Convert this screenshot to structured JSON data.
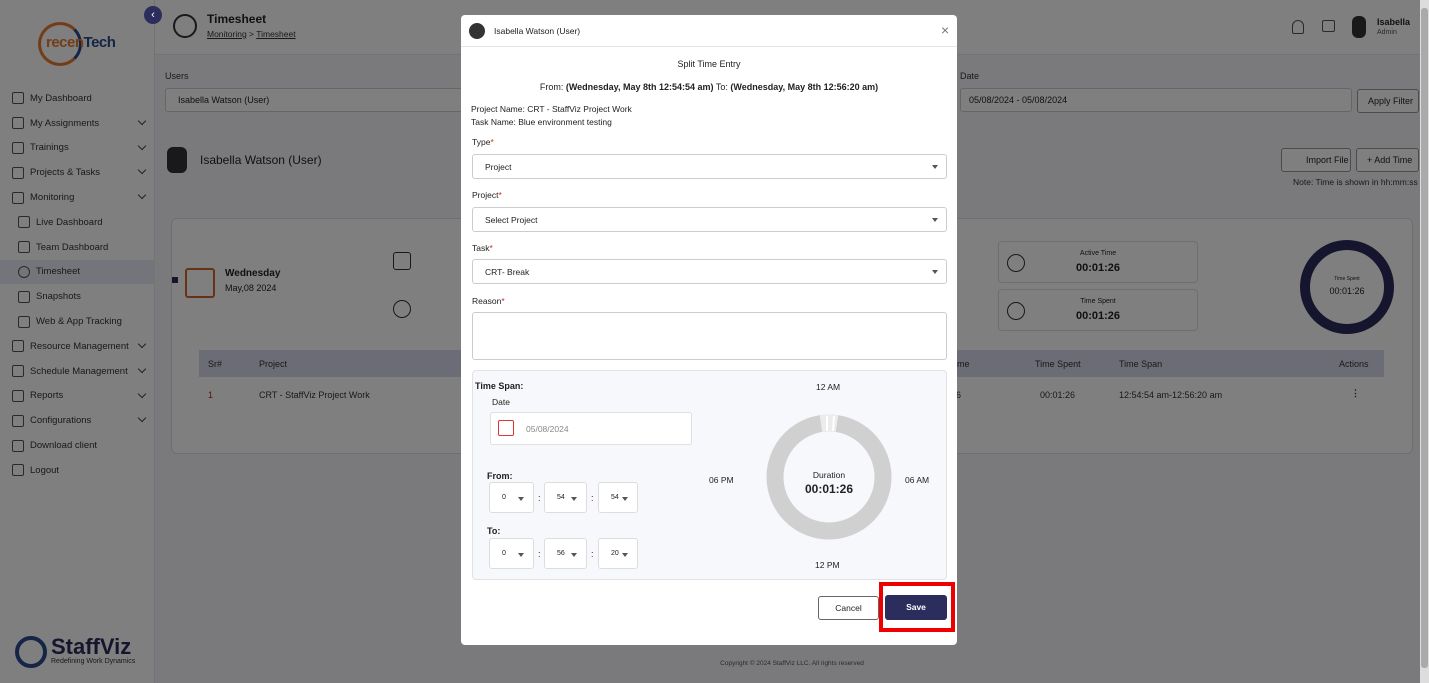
{
  "sidebar": {
    "logo_text_a": "recen",
    "logo_text_b": "Tech",
    "items": [
      {
        "label": "My Dashboard"
      },
      {
        "label": "My Assignments"
      },
      {
        "label": "Trainings"
      },
      {
        "label": "Projects & Tasks"
      },
      {
        "label": "Monitoring"
      },
      {
        "label": "Live Dashboard"
      },
      {
        "label": "Team Dashboard"
      },
      {
        "label": "Timesheet"
      },
      {
        "label": "Snapshots"
      },
      {
        "label": "Web & App Tracking"
      },
      {
        "label": "Resource Management"
      },
      {
        "label": "Schedule Management"
      },
      {
        "label": "Reports"
      },
      {
        "label": "Configurations"
      },
      {
        "label": "Download client"
      },
      {
        "label": "Logout"
      }
    ],
    "brand_name": "StaffViz",
    "brand_tagline": "Redefining Work Dynamics",
    "collapse_glyph": "‹"
  },
  "header": {
    "title": "Timesheet",
    "crumb_1": "Monitoring",
    "crumb_sep": " > ",
    "crumb_2": "Timesheet",
    "user_name": "Isabella",
    "user_role": "Admin"
  },
  "filters": {
    "users_label": "Users",
    "users_value": "Isabella Watson (User)",
    "date_label": "Date",
    "date_value": "05/08/2024 - 05/08/2024",
    "apply_label": "Apply Filter",
    "import_label": "Import File",
    "add_time_label": "+ Add Time",
    "note": "Note: Time is shown in hh:mm:ss"
  },
  "user_row": {
    "name": "Isabella Watson (User)"
  },
  "day": {
    "name": "Wednesday",
    "date": "May,08 2024"
  },
  "stats": [
    {
      "label": "Active Time",
      "value": "00:01:26"
    },
    {
      "label": "Time Spent",
      "value": "00:01:26"
    }
  ],
  "ring": {
    "label": "Time Spent",
    "value": "00:01:26"
  },
  "table": {
    "headers": [
      "Sr#",
      "Project",
      "me",
      "Time Spent",
      "Time Span",
      "Actions"
    ],
    "row": {
      "sr": "1",
      "project": "CRT - StaffViz Project Work",
      "me": "6",
      "time_spent": "00:01:26",
      "span": "12:54:54 am-12:56:20 am",
      "actions": "⋮"
    }
  },
  "footer": "Copyright © 2024 StaffViz LLC. All rights reserved",
  "modal": {
    "user": "Isabella Watson (User)",
    "close": "×",
    "title": "Split Time Entry",
    "range_from_label": "From: ",
    "range_from": "(Wednesday, May 8th 12:54:54 am)",
    "range_to_label": " To: ",
    "range_to": "(Wednesday, May 8th 12:56:20 am)",
    "project_name_label": "Project Name:",
    "project_name": "CRT - StaffViz Project Work",
    "task_name_label": "Task Name:",
    "task_name": "Blue environment testing",
    "type_label": "Type",
    "type_value": "Project",
    "project_label": "Project",
    "project_value": "Select Project",
    "task_label": "Task",
    "task_value": "CRT- Break",
    "reason_label": "Reason",
    "req": "*",
    "timespan_label": "Time Span:",
    "date_label": "Date",
    "date_value": "05/08/2024",
    "from_label": "From:",
    "from": {
      "h": "0",
      "m": "54",
      "s": "54"
    },
    "to_label": "To:",
    "to": {
      "h": "0",
      "m": "56",
      "s": "20"
    },
    "colon": ":",
    "clock": {
      "top": "12 AM",
      "left": "06 PM",
      "right": "06 AM",
      "bottom": "12 PM"
    },
    "duration_label": "Duration",
    "duration_value": "00:01:26",
    "cancel_label": "Cancel",
    "save_label": "Save",
    "colors": {
      "primary": "#2b2d5c",
      "highlight": "#e00000"
    }
  }
}
